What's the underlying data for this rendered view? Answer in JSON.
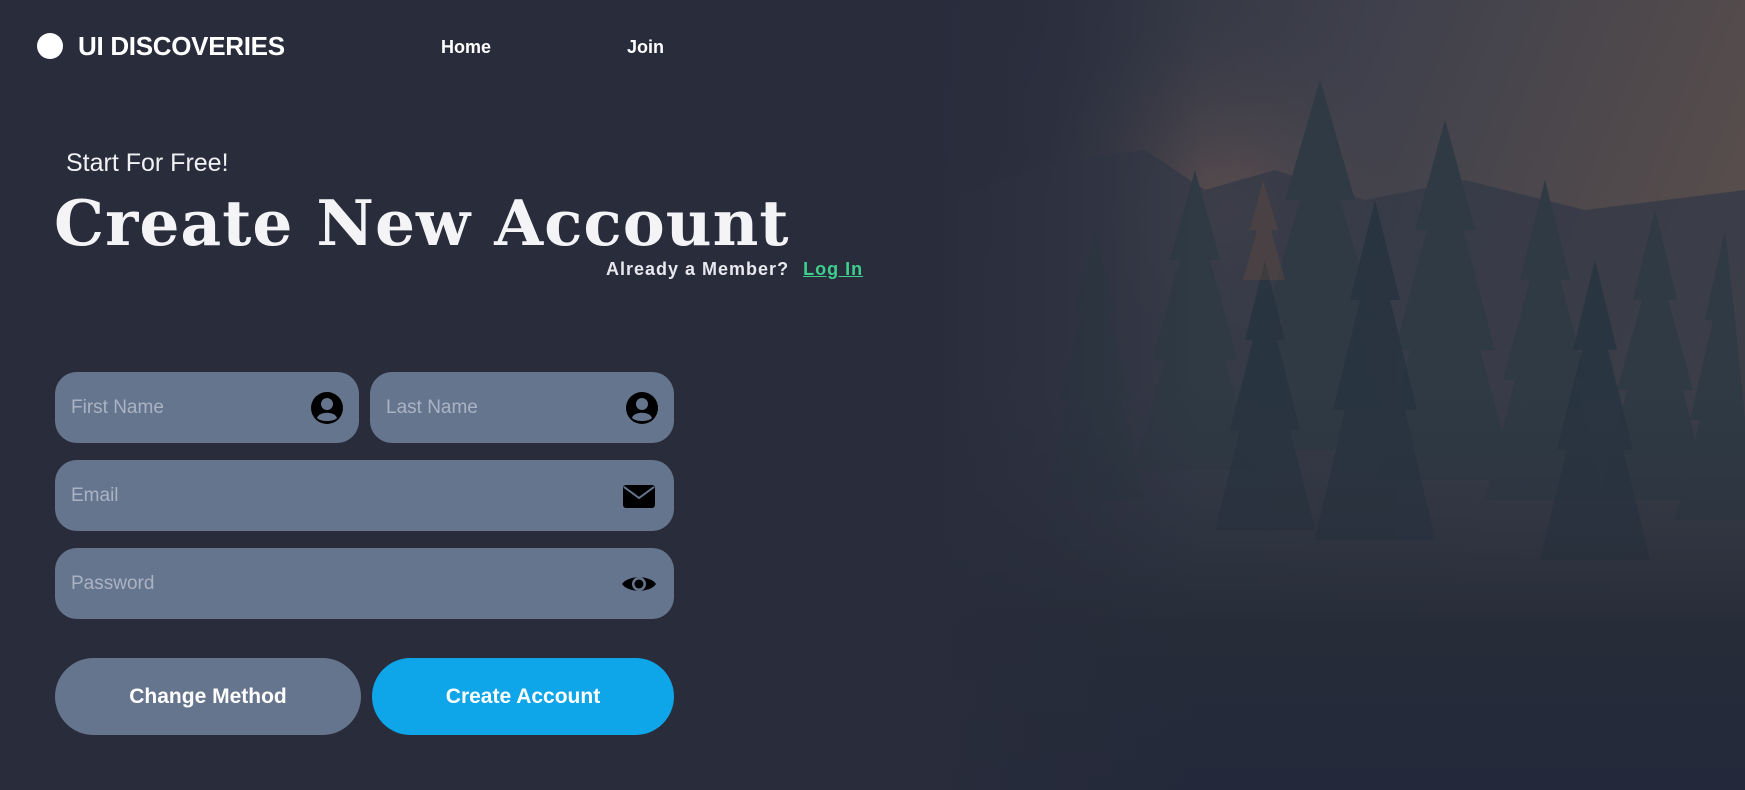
{
  "brand": {
    "name": "UI DISCOVERIES"
  },
  "nav": {
    "items": [
      {
        "label": "Home"
      },
      {
        "label": "Join"
      }
    ]
  },
  "hero": {
    "eyebrow": "Start For Free!",
    "title": "Create New Account",
    "member_prompt": "Already a Member?",
    "login_label": "Log In"
  },
  "form": {
    "first_name": {
      "placeholder": "First Name",
      "value": "",
      "icon": "user-circle-icon"
    },
    "last_name": {
      "placeholder": "Last Name",
      "value": "",
      "icon": "user-circle-icon"
    },
    "email": {
      "placeholder": "Email",
      "value": "",
      "icon": "envelope-icon"
    },
    "password": {
      "placeholder": "Password",
      "value": "",
      "icon": "eye-icon"
    }
  },
  "buttons": {
    "change_method": "Change Method",
    "create_account": "Create Account"
  },
  "colors": {
    "background": "#282c3b",
    "field": "#66758e",
    "primary": "#0fa5e9",
    "link": "#3ecf8e"
  }
}
